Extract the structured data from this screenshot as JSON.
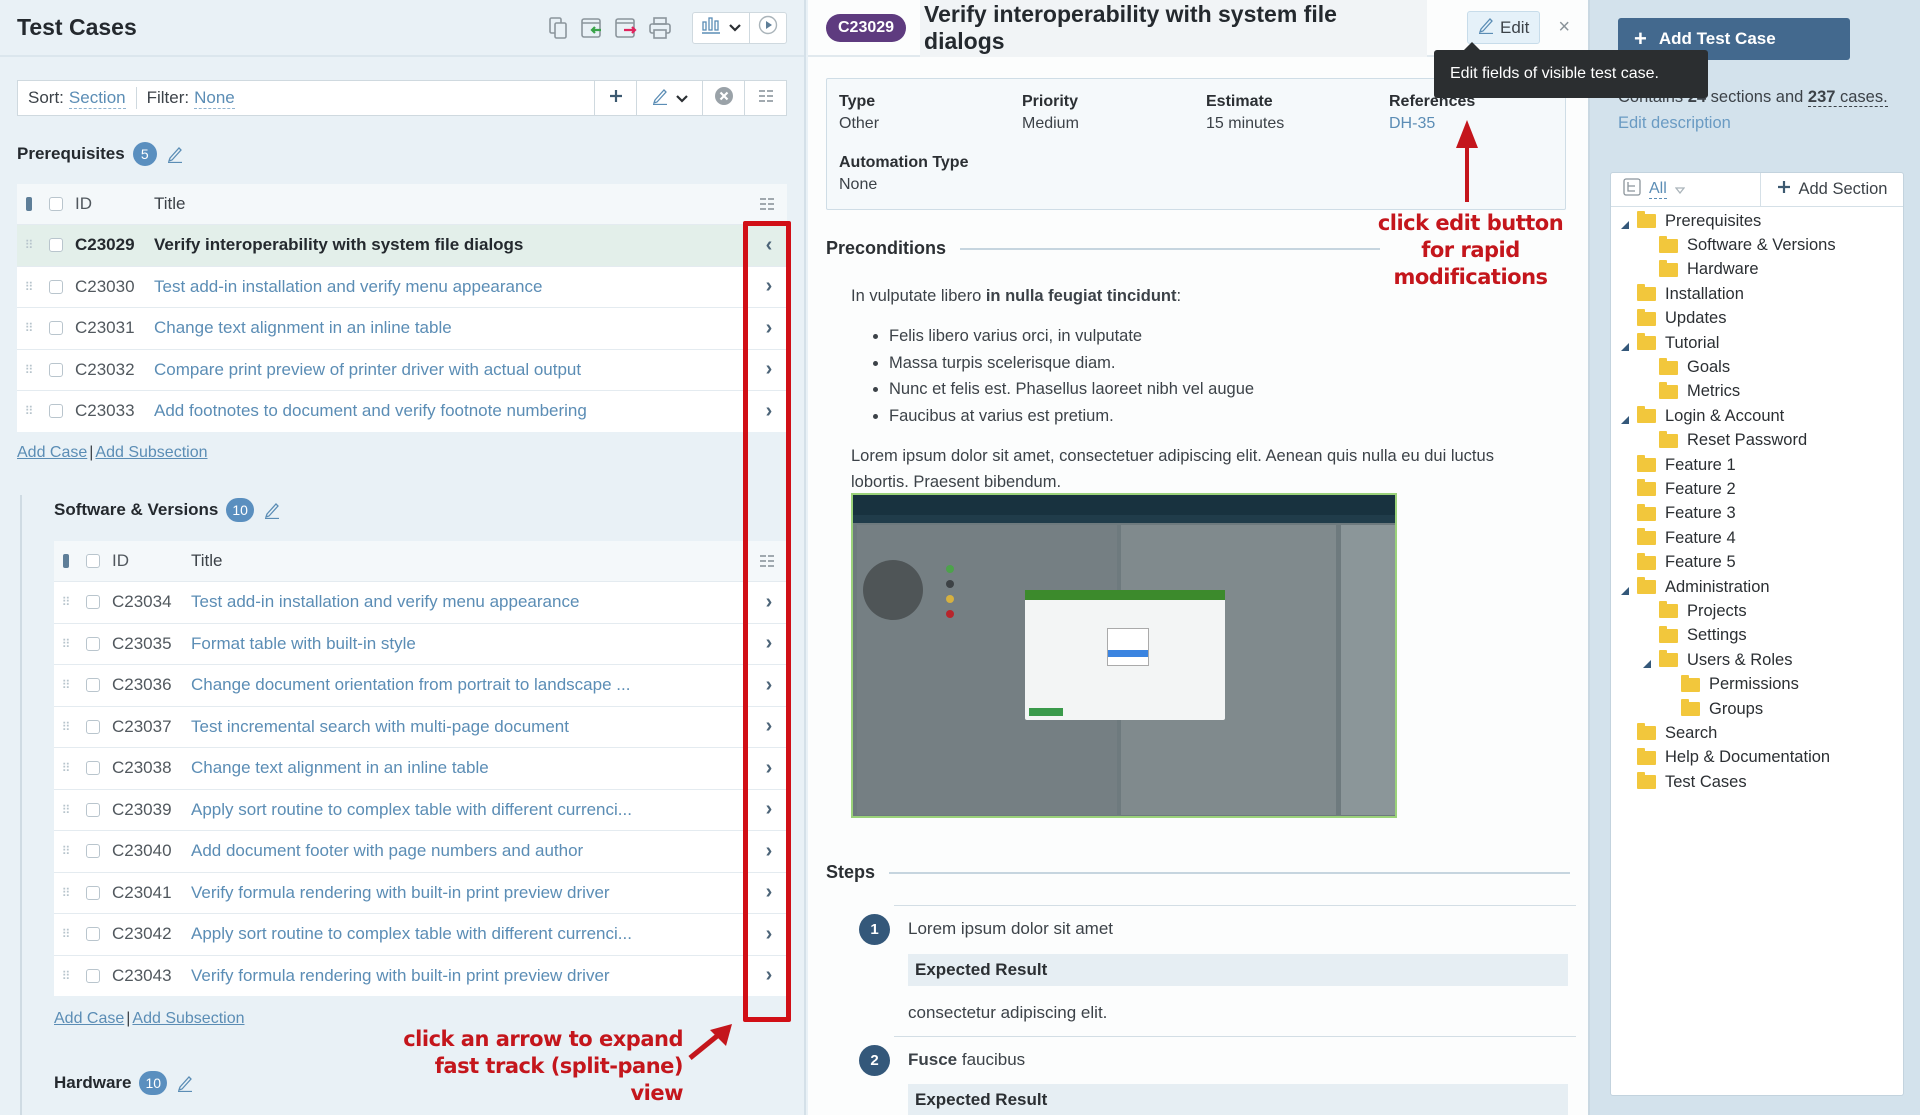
{
  "left": {
    "title": "Test Cases",
    "toolbar_icons": [
      "copy-icon",
      "import-icon",
      "export-icon",
      "print-icon",
      "reports-icon",
      "chevron-down-icon",
      "run-icon"
    ],
    "sort_label": "Sort:",
    "sort_value": "Section",
    "filter_label": "Filter:",
    "filter_value": "None",
    "table_headers": {
      "id": "ID",
      "title": "Title"
    },
    "add_case": "Add Case",
    "add_subsection": "Add Subsection",
    "sections": [
      {
        "name": "Prerequisites",
        "count": "5",
        "rows": [
          {
            "id": "C23029",
            "title": "Verify interoperability with system file dialogs",
            "selected": true,
            "arrow": "‹"
          },
          {
            "id": "C23030",
            "title": "Test add-in installation and verify menu appearance",
            "arrow": "›"
          },
          {
            "id": "C23031",
            "title": "Change text alignment in an inline table",
            "arrow": "›"
          },
          {
            "id": "C23032",
            "title": "Compare print preview of printer driver with actual output",
            "arrow": "›"
          },
          {
            "id": "C23033",
            "title": "Add footnotes to document and verify footnote numbering",
            "arrow": "›"
          }
        ]
      },
      {
        "name": "Software & Versions",
        "count": "10",
        "rows": [
          {
            "id": "C23034",
            "title": "Test add-in installation and verify menu appearance",
            "arrow": "›"
          },
          {
            "id": "C23035",
            "title": "Format table with built-in style",
            "arrow": "›"
          },
          {
            "id": "C23036",
            "title": "Change document orientation from portrait to landscape ...",
            "arrow": "›"
          },
          {
            "id": "C23037",
            "title": "Test incremental search with multi-page document",
            "arrow": "›"
          },
          {
            "id": "C23038",
            "title": "Change text alignment in an inline table",
            "arrow": "›"
          },
          {
            "id": "C23039",
            "title": "Apply sort routine to complex table with different currenci...",
            "arrow": "›"
          },
          {
            "id": "C23040",
            "title": "Add document footer with page numbers and author",
            "arrow": "›"
          },
          {
            "id": "C23041",
            "title": "Verify formula rendering with built-in print preview driver",
            "arrow": "›"
          },
          {
            "id": "C23042",
            "title": "Apply sort routine to complex table with different currenci...",
            "arrow": "›"
          },
          {
            "id": "C23043",
            "title": "Verify formula rendering with built-in print preview driver",
            "arrow": "›"
          }
        ]
      },
      {
        "name": "Hardware",
        "count": "10",
        "rows": []
      }
    ],
    "annotation": [
      "click an arrow to expand",
      "fast track (split-pane) view"
    ]
  },
  "detail": {
    "case_id": "C23029",
    "title": "Verify interoperability with system file dialogs",
    "edit_label": "Edit",
    "close_label": "×",
    "tooltip": "Edit fields of visible test case.",
    "fields": [
      {
        "label": "Type",
        "value": "Other"
      },
      {
        "label": "Priority",
        "value": "Medium"
      },
      {
        "label": "Estimate",
        "value": "15 minutes"
      },
      {
        "label": "References",
        "value": "DH-35",
        "link": true
      },
      {
        "label": "Automation Type",
        "value": "None"
      }
    ],
    "annotation": [
      "click edit button",
      "for rapid modifications"
    ],
    "preconditions": {
      "heading": "Preconditions",
      "intro_plain": "In vulputate libero ",
      "intro_bold": "in nulla feugiat tincidunt",
      "intro_end": ":",
      "bullets": [
        "Felis libero varius orci, in vulputate",
        "Massa turpis scelerisque diam.",
        "Nunc et felis est. Phasellus laoreet nibh vel augue",
        "Faucibus at varius est pretium."
      ],
      "paragraph": "Lorem ipsum dolor sit amet, consectetuer adipiscing elit. Aenean quis nulla eu dui luctus lobortis. Praesent bibendum.",
      "image_alt": "embedded-screenshot"
    },
    "steps": {
      "heading": "Steps",
      "items": [
        {
          "num": "1",
          "text_bold": "",
          "text": "Lorem ipsum dolor sit amet",
          "expected_label": "Expected Result",
          "expected": "consectetur adipiscing elit."
        },
        {
          "num": "2",
          "text_bold": "Fusce",
          "text": " faucibus",
          "expected_label": "Expected Result",
          "expected": ""
        }
      ]
    }
  },
  "sidebar": {
    "add_test_case": "Add Test Case",
    "contains_prefix": "Contains ",
    "sections_count": "24",
    "contains_mid": " sections and ",
    "cases_count": "237",
    "contains_suffix": " cases.",
    "edit_description": "Edit description",
    "filter_all": "All",
    "add_section": "Add Section",
    "tree": [
      {
        "label": "Prerequisites",
        "level": 0,
        "expanded": true
      },
      {
        "label": "Software & Versions",
        "level": 1
      },
      {
        "label": "Hardware",
        "level": 1
      },
      {
        "label": "Installation",
        "level": 0
      },
      {
        "label": "Updates",
        "level": 0
      },
      {
        "label": "Tutorial",
        "level": 0,
        "expanded": true
      },
      {
        "label": "Goals",
        "level": 1
      },
      {
        "label": "Metrics",
        "level": 1
      },
      {
        "label": "Login & Account",
        "level": 0,
        "expanded": true
      },
      {
        "label": "Reset Password",
        "level": 1
      },
      {
        "label": "Feature 1",
        "level": 0
      },
      {
        "label": "Feature 2",
        "level": 0
      },
      {
        "label": "Feature 3",
        "level": 0
      },
      {
        "label": "Feature 4",
        "level": 0
      },
      {
        "label": "Feature 5",
        "level": 0
      },
      {
        "label": "Administration",
        "level": 0,
        "expanded": true
      },
      {
        "label": "Projects",
        "level": 1
      },
      {
        "label": "Settings",
        "level": 1
      },
      {
        "label": "Users & Roles",
        "level": 1,
        "expanded": true
      },
      {
        "label": "Permissions",
        "level": 2
      },
      {
        "label": "Groups",
        "level": 2
      },
      {
        "label": "Search",
        "level": 0
      },
      {
        "label": "Help & Documentation",
        "level": 0
      },
      {
        "label": "Test Cases",
        "level": 0
      }
    ]
  },
  "colors": {
    "accent": "#5b8db5",
    "case_pill": "#5e3b7f",
    "primary_button": "#43698e",
    "annotation_red": "#c4161c",
    "selected_row": "#e3efea",
    "folder": "#f2c73c"
  }
}
